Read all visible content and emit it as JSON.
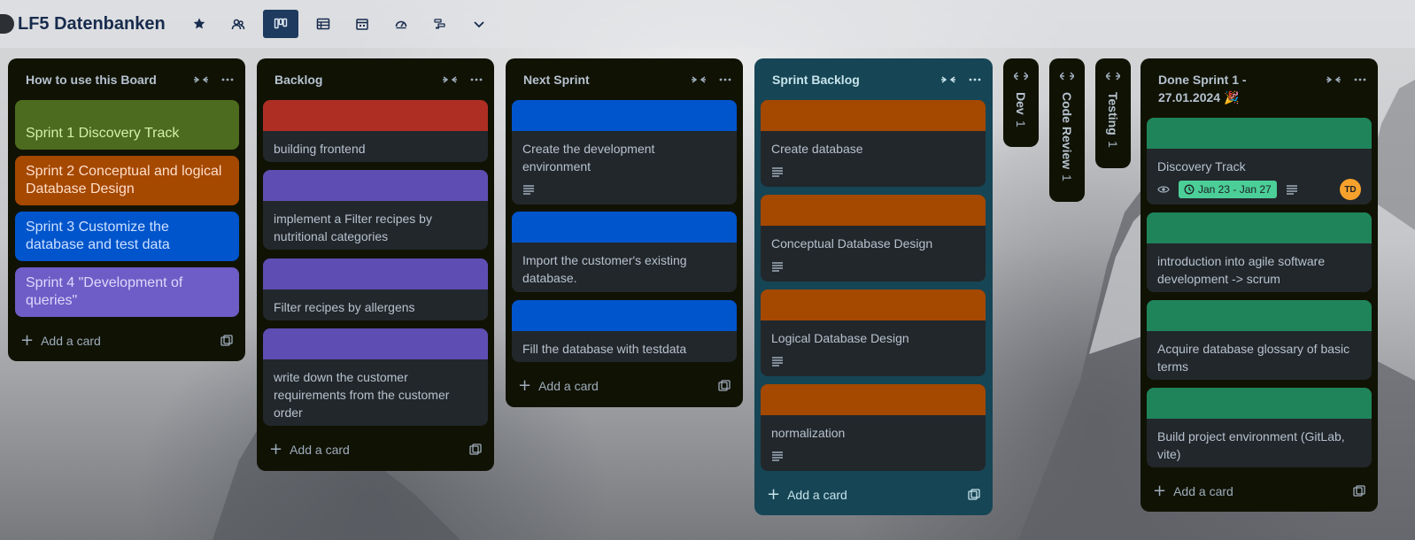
{
  "header": {
    "board_title": "LF5 Datenbanken",
    "icons": [
      "star-icon",
      "workspace-visibility-icon",
      "board-view-icon",
      "table-view-icon",
      "calendar-view-icon",
      "dashboard-view-icon",
      "timeline-view-icon",
      "chevron-down-icon"
    ]
  },
  "lists": {
    "how_to": {
      "title": "How to use this Board",
      "cards": [
        {
          "title": "Sprint 1 Discovery Track",
          "color": "#4c6b1f",
          "text_color": "#d3f1a7"
        },
        {
          "title": "Sprint 2 Conceptual and logical Database Design",
          "color": "#a54800",
          "text_color": "#fedec8"
        },
        {
          "title": "Sprint 3 Customize the database and test data",
          "color": "#0055cc",
          "text_color": "#cce0ff"
        },
        {
          "title": "Sprint 4 \"Development of queries\"",
          "color": "#6e5dc6",
          "text_color": "#dfd8fd"
        }
      ],
      "add_label": "Add a card"
    },
    "backlog": {
      "title": "Backlog",
      "cards": [
        {
          "title": "building frontend",
          "cover": "#ae2e24"
        },
        {
          "title": "implement a Filter recipes by nutritional categories",
          "cover": "#5e4db2"
        },
        {
          "title": "Filter recipes by allergens",
          "cover": "#5e4db2"
        },
        {
          "title": "write down the customer requirements from the customer order",
          "cover": "#5e4db2"
        }
      ],
      "add_label": "Add a card"
    },
    "next_sprint": {
      "title": "Next Sprint",
      "cards": [
        {
          "title": "Create the development environment",
          "cover": "#0055cc",
          "has_description": true
        },
        {
          "title": "Import the customer's existing database.",
          "cover": "#0055cc"
        },
        {
          "title": "Fill the database with testdata",
          "cover": "#0055cc"
        }
      ],
      "add_label": "Add a card"
    },
    "sprint_backlog": {
      "title": "Sprint Backlog",
      "color": "#164555",
      "cards": [
        {
          "title": "Create database",
          "cover": "#a54800",
          "has_description": true
        },
        {
          "title": "Conceptual Database Design",
          "cover": "#a54800",
          "has_description": true
        },
        {
          "title": "Logical Database Design",
          "cover": "#a54800",
          "has_description": true
        },
        {
          "title": "normalization",
          "cover": "#a54800",
          "has_description": true
        }
      ],
      "add_label": "Add a card"
    },
    "collapsed": [
      {
        "name": "Dev",
        "count": "1"
      },
      {
        "name": "Code Review",
        "count": "1"
      },
      {
        "name": "Testing",
        "count": "1"
      }
    ],
    "done": {
      "title": "Done Sprint 1 - 27.01.2024 🎉",
      "cards": [
        {
          "title": "Discovery Track",
          "cover": "#1f845a",
          "date": "Jan 23 - Jan 27",
          "member_initials": "TD"
        },
        {
          "title": "introduction into agile software development -> scrum",
          "cover": "#1f845a"
        },
        {
          "title": "Acquire database glossary of basic terms",
          "cover": "#1f845a"
        },
        {
          "title": "Build project environment (GitLab, vite)",
          "cover": "#1f845a"
        }
      ],
      "add_label": "Add a card"
    }
  }
}
